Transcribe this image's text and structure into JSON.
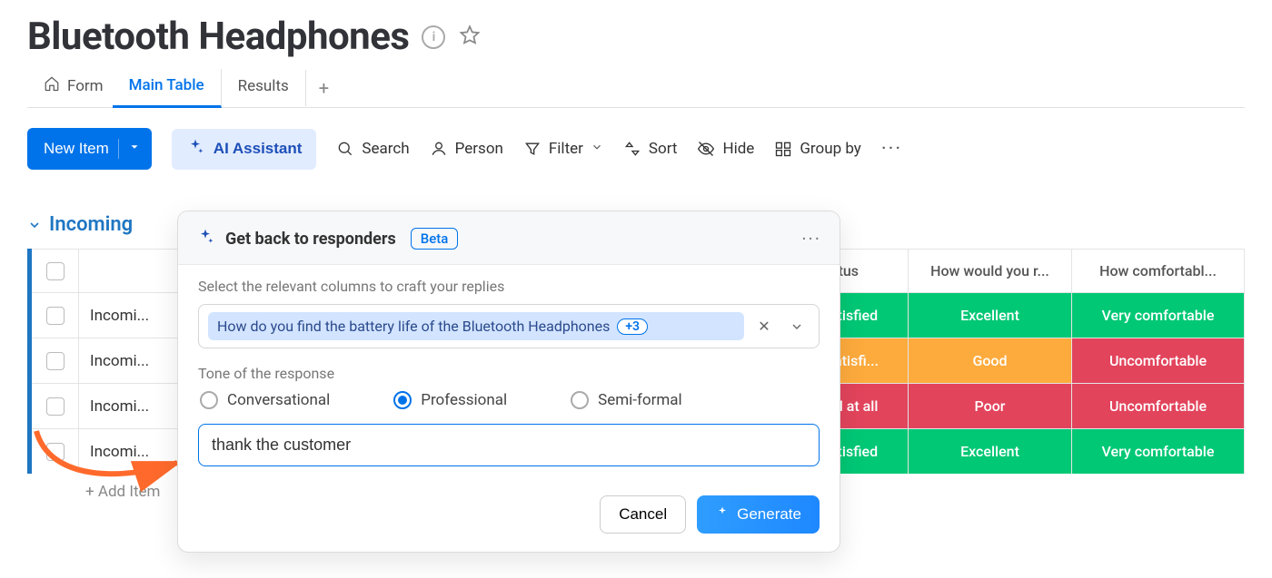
{
  "header": {
    "title": "Bluetooth Headphones"
  },
  "tabs": {
    "form": "Form",
    "main": "Main Table",
    "results": "Results",
    "add": "+"
  },
  "toolbar": {
    "new_item": "New Item",
    "ai_assistant": "AI Assistant",
    "search": "Search",
    "person": "Person",
    "filter": "Filter",
    "sort": "Sort",
    "hide": "Hide",
    "group_by": "Group by",
    "more": "···"
  },
  "group": {
    "name": "Incoming"
  },
  "columns": {
    "status": "atus",
    "rating": "How would you r...",
    "comfort": "How comfortabl..."
  },
  "rows": [
    {
      "name": "Incomi...",
      "status": {
        "text": "y satisfied",
        "color": "green"
      },
      "rating": {
        "text": "Excellent",
        "color": "green"
      },
      "comfort": {
        "text": "Very comfortable",
        "color": "green"
      }
    },
    {
      "name": "Incomi...",
      "status": {
        "text": "at satisfi...",
        "color": "orange"
      },
      "rating": {
        "text": "Good",
        "color": "orange"
      },
      "comfort": {
        "text": "Uncomfortable",
        "color": "red"
      }
    },
    {
      "name": "Incomi...",
      "status": {
        "text": "sfied at all",
        "color": "red"
      },
      "rating": {
        "text": "Poor",
        "color": "red"
      },
      "comfort": {
        "text": "Uncomfortable",
        "color": "red"
      }
    },
    {
      "name": "Incomi...",
      "status": {
        "text": "y satisfied",
        "color": "green"
      },
      "rating": {
        "text": "Excellent",
        "color": "green"
      },
      "comfort": {
        "text": "Very comfortable",
        "color": "green"
      }
    }
  ],
  "add_item": "+ Add Item",
  "popover": {
    "title": "Get back to responders",
    "badge": "Beta",
    "columns_label": "Select the relevant columns to craft your replies",
    "chip": "How do you find the battery life of the Bluetooth Headphones",
    "chip_more": "+3",
    "tone_label": "Tone of the response",
    "tone_options": {
      "a": "Conversational",
      "b": "Professional",
      "c": "Semi-formal"
    },
    "prompt_value": "thank the customer",
    "cancel": "Cancel",
    "generate": "Generate"
  }
}
